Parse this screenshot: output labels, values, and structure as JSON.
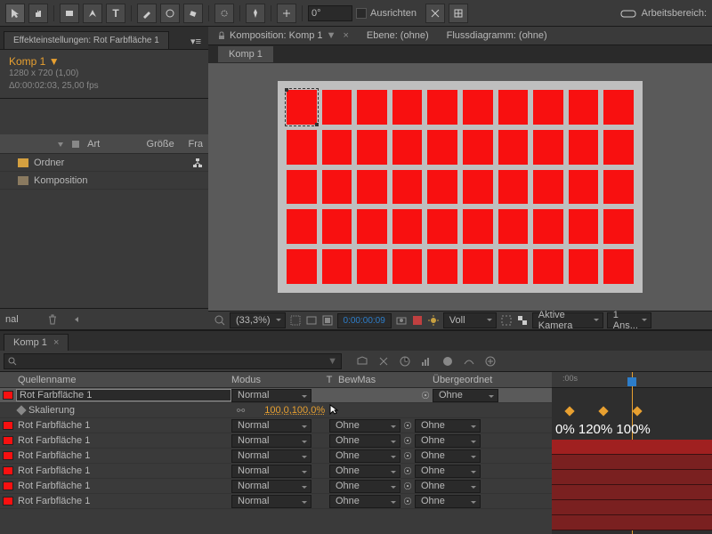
{
  "toolbar": {
    "rotation": "0°",
    "align_label": "Ausrichten",
    "workspace_label": "Arbeitsbereich:"
  },
  "effect_panel": {
    "tab_label": "Effekteinstellungen: Rot Farbfläche 1",
    "comp_name": "Komp 1 ▼",
    "resolution": "1280 x 720 (1,00)",
    "duration": "Δ0:00:02:03, 25,00 fps"
  },
  "project_panel": {
    "col_art": "Art",
    "col_size": "Größe",
    "col_fr": "Fra",
    "items": [
      {
        "type": "folder",
        "name": "Ordner"
      },
      {
        "type": "comp",
        "name": "Komposition"
      }
    ],
    "bottom_nal": "nal"
  },
  "viewer": {
    "tabs": {
      "comp": "Komposition: Komp 1",
      "layer": "Ebene: (ohne)",
      "flow": "Flussdiagramm: (ohne)"
    },
    "subtab": "Komp 1",
    "zoom": "(33,3%)",
    "timecode": "0:00:00:09",
    "quality": "Voll",
    "camera": "Aktive Kamera",
    "views": "1 Ans..."
  },
  "timeline": {
    "tab": "Komp 1",
    "ruler_start": ":00s",
    "columns": {
      "name": "Quellenname",
      "mode": "Modus",
      "t": "T",
      "bew": "BewMas",
      "parent": "Übergeordnet"
    },
    "property": {
      "name": "Skalierung",
      "value": "100,0,100,0%"
    },
    "mode_normal": "Normal",
    "track_ohne": "Ohne",
    "parent_ohne": "Ohne",
    "layers": [
      {
        "name": "Rot Farbfläche 1",
        "selected": true
      },
      {
        "name": "Rot Farbfläche 1"
      },
      {
        "name": "Rot Farbfläche 1"
      },
      {
        "name": "Rot Farbfläche 1"
      },
      {
        "name": "Rot Farbfläche 1"
      },
      {
        "name": "Rot Farbfläche 1"
      },
      {
        "name": "Rot Farbfläche 1"
      }
    ],
    "keyframe_labels": "0% 120% 100%"
  }
}
